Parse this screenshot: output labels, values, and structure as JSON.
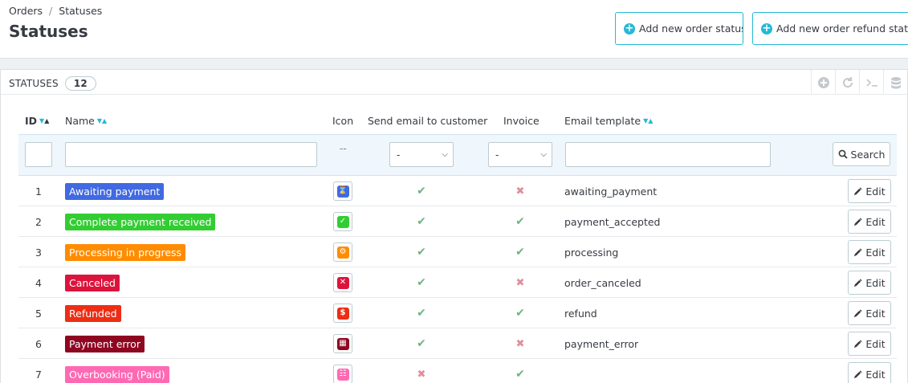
{
  "breadcrumb": {
    "parent": "Orders",
    "separator": "/",
    "current": "Statuses"
  },
  "page_title": "Statuses",
  "toolbar": {
    "add_status_label": "Add new order status",
    "add_refund_status_label": "Add new order refund status"
  },
  "panel": {
    "title": "STATUSES",
    "count": "12"
  },
  "columns": {
    "id": "ID",
    "name": "Name",
    "icon": "Icon",
    "send_email": "Send email to customer",
    "invoice": "Invoice",
    "email_template": "Email template"
  },
  "filters": {
    "icon_placeholder": "--",
    "send_email_selected": "-",
    "invoice_selected": "-",
    "search_label": "Search"
  },
  "edit_label": "Edit",
  "rows": [
    {
      "id": "1",
      "name": "Awaiting payment",
      "color": "#4169e1",
      "icon": "hourglass-icon",
      "send_email": true,
      "invoice": false,
      "template": "awaiting_payment"
    },
    {
      "id": "2",
      "name": "Complete payment received",
      "color": "#32cd32",
      "icon": "check-square-icon",
      "send_email": true,
      "invoice": true,
      "template": "payment_accepted"
    },
    {
      "id": "3",
      "name": "Processing in progress",
      "color": "#ff8c00",
      "icon": "gear-icon",
      "send_email": true,
      "invoice": true,
      "template": "processing"
    },
    {
      "id": "4",
      "name": "Canceled",
      "color": "#dc143c",
      "icon": "cancel-square-icon",
      "send_email": true,
      "invoice": false,
      "template": "order_canceled"
    },
    {
      "id": "5",
      "name": "Refunded",
      "color": "#ec2e15",
      "icon": "refund-coin-icon",
      "send_email": true,
      "invoice": true,
      "template": "refund"
    },
    {
      "id": "6",
      "name": "Payment error",
      "color": "#8f0621",
      "icon": "card-error-icon",
      "send_email": true,
      "invoice": false,
      "template": "payment_error"
    },
    {
      "id": "7",
      "name": "Overbooking (Paid)",
      "color": "#ff69b4",
      "icon": "overbooking-icon",
      "send_email": false,
      "invoice": true,
      "template": ""
    }
  ]
}
